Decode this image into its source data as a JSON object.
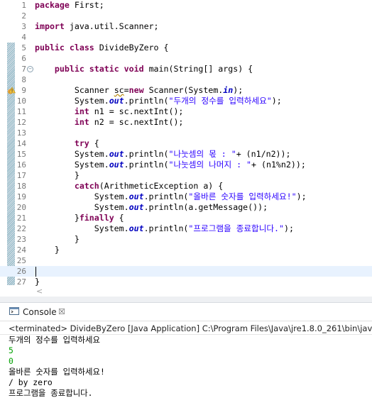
{
  "editor": {
    "current_line": 26,
    "lines": [
      {
        "n": "1",
        "t": [
          {
            "s": "package",
            "c": "kw"
          },
          {
            "s": " First;"
          }
        ]
      },
      {
        "n": "2",
        "t": []
      },
      {
        "n": "3",
        "t": [
          {
            "s": "import",
            "c": "kw"
          },
          {
            "s": " java.util.Scanner;"
          }
        ]
      },
      {
        "n": "4",
        "t": []
      },
      {
        "n": "5",
        "t": [
          {
            "s": "public",
            "c": "kw"
          },
          {
            "s": " "
          },
          {
            "s": "class",
            "c": "kw"
          },
          {
            "s": " DivideByZero {"
          }
        ]
      },
      {
        "n": "6",
        "t": []
      },
      {
        "n": "7",
        "fold": "−",
        "t": [
          {
            "s": "    "
          },
          {
            "s": "public",
            "c": "kw"
          },
          {
            "s": " "
          },
          {
            "s": "static",
            "c": "kw"
          },
          {
            "s": " "
          },
          {
            "s": "void",
            "c": "kw"
          },
          {
            "s": " main(String[] args) {"
          }
        ]
      },
      {
        "n": "8",
        "t": []
      },
      {
        "n": "9",
        "t": [
          {
            "s": "        Scanner "
          },
          {
            "s": "sc",
            "c": "warn"
          },
          {
            "s": "="
          },
          {
            "s": "new",
            "c": "kw"
          },
          {
            "s": " Scanner(System."
          },
          {
            "s": "in",
            "c": "fld"
          },
          {
            "s": ");"
          }
        ]
      },
      {
        "n": "10",
        "t": [
          {
            "s": "        System."
          },
          {
            "s": "out",
            "c": "fld"
          },
          {
            "s": ".println("
          },
          {
            "s": "\"두개의 정수를 입력하세요\"",
            "c": "str"
          },
          {
            "s": ");"
          }
        ]
      },
      {
        "n": "11",
        "t": [
          {
            "s": "        "
          },
          {
            "s": "int",
            "c": "kw"
          },
          {
            "s": " n1 = sc.nextInt();"
          }
        ]
      },
      {
        "n": "12",
        "t": [
          {
            "s": "        "
          },
          {
            "s": "int",
            "c": "kw"
          },
          {
            "s": " n2 = sc.nextInt();"
          }
        ]
      },
      {
        "n": "13",
        "t": []
      },
      {
        "n": "14",
        "t": [
          {
            "s": "        "
          },
          {
            "s": "try",
            "c": "kw"
          },
          {
            "s": " {"
          }
        ]
      },
      {
        "n": "15",
        "t": [
          {
            "s": "        System."
          },
          {
            "s": "out",
            "c": "fld"
          },
          {
            "s": ".println("
          },
          {
            "s": "\"나눗셈의 몫 : \"",
            "c": "str"
          },
          {
            "s": "+ (n1/n2));"
          }
        ]
      },
      {
        "n": "16",
        "t": [
          {
            "s": "        System."
          },
          {
            "s": "out",
            "c": "fld"
          },
          {
            "s": ".println("
          },
          {
            "s": "\"나눗셈의 나머지 : \"",
            "c": "str"
          },
          {
            "s": "+ (n1%n2));"
          }
        ]
      },
      {
        "n": "17",
        "t": [
          {
            "s": "        }"
          }
        ]
      },
      {
        "n": "18",
        "t": [
          {
            "s": "        "
          },
          {
            "s": "catch",
            "c": "kw"
          },
          {
            "s": "(ArithmeticException a) {"
          }
        ]
      },
      {
        "n": "19",
        "t": [
          {
            "s": "            System."
          },
          {
            "s": "out",
            "c": "fld"
          },
          {
            "s": ".println("
          },
          {
            "s": "\"올바른 숫자를 입력하세요!\"",
            "c": "str"
          },
          {
            "s": ");"
          }
        ]
      },
      {
        "n": "20",
        "t": [
          {
            "s": "            System."
          },
          {
            "s": "out",
            "c": "fld"
          },
          {
            "s": ".println(a.getMessage());"
          }
        ]
      },
      {
        "n": "21",
        "t": [
          {
            "s": "        }"
          },
          {
            "s": "finally",
            "c": "kw"
          },
          {
            "s": " {"
          }
        ]
      },
      {
        "n": "22",
        "t": [
          {
            "s": "            System."
          },
          {
            "s": "out",
            "c": "fld"
          },
          {
            "s": ".println("
          },
          {
            "s": "\"프로그램을 종료합니다.\"",
            "c": "str"
          },
          {
            "s": ");"
          }
        ]
      },
      {
        "n": "23",
        "t": [
          {
            "s": "        }"
          }
        ]
      },
      {
        "n": "24",
        "t": [
          {
            "s": "    }"
          }
        ]
      },
      {
        "n": "25",
        "t": []
      },
      {
        "n": "26",
        "t": []
      },
      {
        "n": "27",
        "t": [
          {
            "s": "}"
          }
        ]
      }
    ]
  },
  "console": {
    "tab_label": "Console",
    "close_glyph": "☒",
    "terminated": "<terminated> DivideByZero [Java Application] C:\\Program Files\\Java\\jre1.8.0_261\\bin\\javaw",
    "output": [
      {
        "text": "두개의 정수를 입력하세요",
        "kind": "out"
      },
      {
        "text": "5",
        "kind": "in"
      },
      {
        "text": "0",
        "kind": "in"
      },
      {
        "text": "올바른 숫자를 입력하세요!",
        "kind": "out"
      },
      {
        "text": "/ by zero",
        "kind": "out"
      },
      {
        "text": "프로그램을 종료합니다.",
        "kind": "out"
      }
    ]
  },
  "icons": {
    "warning": "warning-icon",
    "console": "console-icon",
    "scroll_left": "scroll-left-arrow-icon"
  }
}
